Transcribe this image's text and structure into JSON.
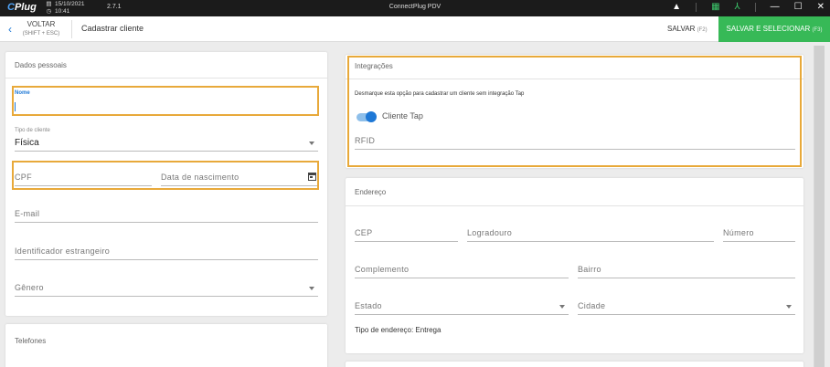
{
  "titlebar": {
    "logo_a": "C",
    "logo_b": "Plug",
    "date": "15/10/2021",
    "time": "10:41",
    "version": "2.7.1",
    "app_name": "ConnectPlug PDV"
  },
  "actionbar": {
    "back_label": "VOLTAR",
    "back_shortcut": "(SHIFT + ESC)",
    "page_title": "Cadastrar cliente",
    "save_label": "SALVAR",
    "save_shortcut": "(F2)",
    "save_select_label": "SALVAR E SELECIONAR",
    "save_select_shortcut": "(F3)"
  },
  "personal": {
    "title": "Dados pessoais",
    "nome_label": "Nome",
    "nome_value": "",
    "tipo_label": "Tipo de cliente",
    "tipo_value": "Física",
    "cpf_placeholder": "CPF",
    "nascimento_placeholder": "Data de nascimento",
    "email_placeholder": "E-mail",
    "estrangeiro_placeholder": "Identificador estrangeiro",
    "genero_placeholder": "Gênero"
  },
  "phones": {
    "title": "Telefones"
  },
  "integrations": {
    "title": "Integrações",
    "hint": "Desmarque esta opção para cadastrar um cliente sem integração Tap",
    "toggle_label": "Cliente Tap",
    "toggle_on": true,
    "rfid_placeholder": "RFID"
  },
  "address": {
    "title": "Endereço",
    "cep": "CEP",
    "logradouro": "Logradouro",
    "numero": "Número",
    "complemento": "Complemento",
    "bairro": "Bairro",
    "estado": "Estado",
    "cidade": "Cidade",
    "tipo_endereco": "Tipo de endereço: Entrega"
  },
  "colors": {
    "accent": "#1e78d6",
    "primary_button": "#37b957",
    "highlight": "#e8a93a"
  }
}
